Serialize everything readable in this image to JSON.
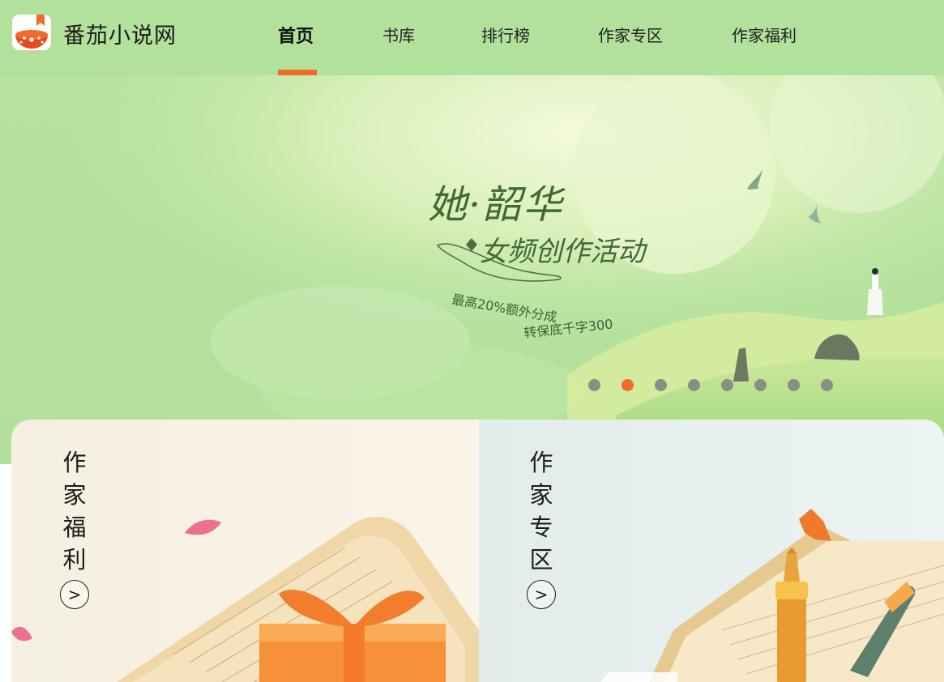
{
  "header": {
    "brand": "番茄小说网",
    "nav": [
      {
        "label": "首页",
        "active": true
      },
      {
        "label": "书库",
        "active": false
      },
      {
        "label": "排行榜",
        "active": false
      },
      {
        "label": "作家专区",
        "active": false
      },
      {
        "label": "作家福利",
        "active": false
      }
    ],
    "logo_icon": "tomato-book-icon",
    "accent_color": "#f26a2a",
    "header_bg": "#b1e19a"
  },
  "hero": {
    "title": "她·韶华",
    "subtitle": "女频创作活动",
    "line1": "最高20%额外分成",
    "line2": "转保底千字300",
    "carousel_total": 8,
    "carousel_active_index": 1
  },
  "cards": [
    {
      "title": "作家福利",
      "arrow": ">",
      "icon": "gift-box-icon"
    },
    {
      "title": "作家专区",
      "arrow": ">",
      "icon": "fountain-pen-icon"
    }
  ]
}
